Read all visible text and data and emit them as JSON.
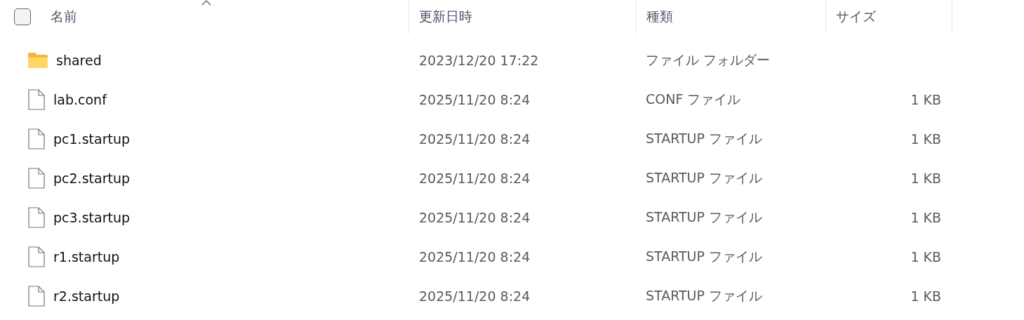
{
  "header": {
    "select_all": {
      "checked": false
    },
    "columns": [
      {
        "label": "名前",
        "sorted": true
      },
      {
        "label": "更新日時",
        "sorted": false
      },
      {
        "label": "種類",
        "sorted": false
      },
      {
        "label": "サイズ",
        "sorted": false
      }
    ]
  },
  "rows": [
    {
      "kind": "folder",
      "name": "shared",
      "modified": "2023/12/20 17:22",
      "type": "ファイル フォルダー"
    },
    {
      "kind": "file",
      "name": "lab.conf",
      "modified": "2025/11/20 8:24",
      "type": "CONF ファイル",
      "size": "1 KB"
    },
    {
      "kind": "file",
      "name": "pc1.startup",
      "modified": "2025/11/20 8:24",
      "type": "STARTUP ファイル",
      "size": "1 KB"
    },
    {
      "kind": "file",
      "name": "pc2.startup",
      "modified": "2025/11/20 8:24",
      "type": "STARTUP ファイル",
      "size": "1 KB"
    },
    {
      "kind": "file",
      "name": "pc3.startup",
      "modified": "2025/11/20 8:24",
      "type": "STARTUP ファイル",
      "size": "1 KB"
    },
    {
      "kind": "file",
      "name": "r1.startup",
      "modified": "2025/11/20 8:24",
      "type": "STARTUP ファイル",
      "size": "1 KB"
    },
    {
      "kind": "file",
      "name": "r2.startup",
      "modified": "2025/11/20 8:24",
      "type": "STARTUP ファイル",
      "size": "1 KB"
    }
  ]
}
